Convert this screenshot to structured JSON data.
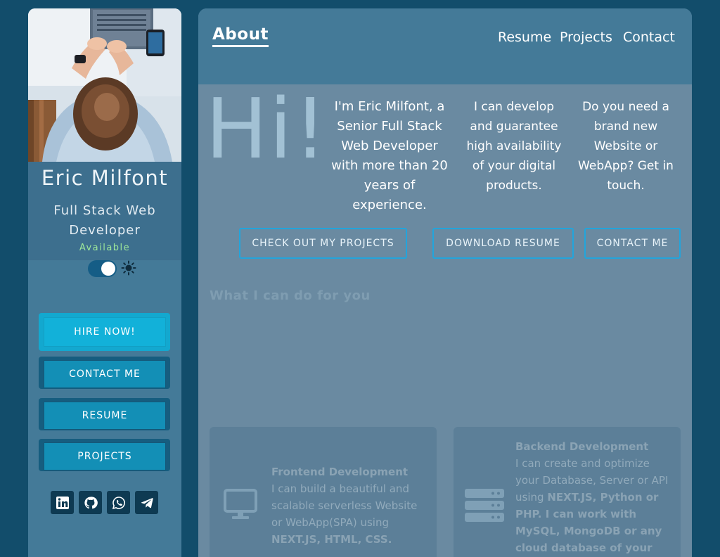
{
  "sidebar": {
    "name": "Eric Milfont",
    "title": "Full Stack Web Developer",
    "status": "Available",
    "buttons": {
      "hire": "HIRE NOW!",
      "contact": "CONTACT ME",
      "resume": "RESUME",
      "projects": "PROJECTS"
    },
    "theme_toggle_on": true,
    "socials": [
      "linkedin-icon",
      "github-icon",
      "whatsapp-icon",
      "telegram-icon"
    ]
  },
  "nav": {
    "about": "About",
    "resume": "Resume",
    "projects": "Projects",
    "contact": "Contact"
  },
  "hero": {
    "greeting": "Hi!",
    "intro_1": "I'm Eric Milfont, a Senior Full Stack Web Developer with more than 20 years of experience.",
    "intro_2": "I can develop and guarantee high availability of your digital products.",
    "intro_3": "Do you need a brand new Website or WebApp? Get in touch."
  },
  "cta": {
    "projects": "CHECK OUT MY PROJECTS",
    "resume": "DOWNLOAD RESUME",
    "contact": "CONTACT ME"
  },
  "services": {
    "title": "What I can do for you",
    "frontend": {
      "title": "Frontend Development",
      "text": "I can build a beautiful and scalable serverless Website or WebApp(SPA) using",
      "tech": "NEXT.JS, HTML, CSS."
    },
    "backend": {
      "title": "Backend Development",
      "text": "I can create and optimize your Database, Server or API using",
      "tech": "NEXT.JS, Python or PHP. I can work with MySQL, MongoDB or any cloud database of your"
    }
  },
  "colors": {
    "page_bg": "#124d6b",
    "panel_bg": "#6a8aa1",
    "accent": "#12b1d9",
    "status_green": "#9ee89a"
  }
}
